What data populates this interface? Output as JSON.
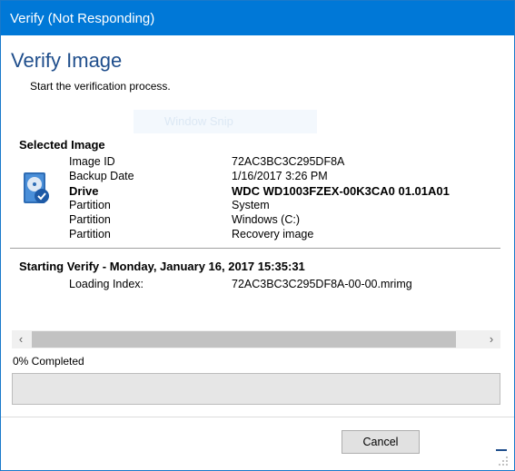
{
  "window": {
    "title": "Verify (Not Responding)"
  },
  "header": {
    "title": "Verify Image",
    "subtitle": "Start the verification process."
  },
  "ghost_overlay": {
    "text": "Window Snip"
  },
  "selected_image": {
    "title": "Selected Image",
    "icon": "hard-drive-icon",
    "rows": [
      {
        "label": "Image ID",
        "value": "72AC3BC3C295DF8A",
        "bold": false
      },
      {
        "label": "Backup Date",
        "value": "1/16/2017 3:26 PM",
        "bold": false
      },
      {
        "label": "Drive",
        "value": "WDC WD1003FZEX-00K3CA0 01.01A01",
        "bold": true
      },
      {
        "label": "Partition",
        "value": "System",
        "bold": false
      },
      {
        "label": "Partition",
        "value": "Windows (C:)",
        "bold": false
      },
      {
        "label": "Partition",
        "value": "Recovery image",
        "bold": false
      }
    ]
  },
  "verify": {
    "title": "Starting Verify - Monday, January 16, 2017 15:35:31",
    "rows": [
      {
        "label": "Loading Index:",
        "value": "72AC3BC3C295DF8A-00-00.mrimg"
      }
    ]
  },
  "scrollbar": {
    "left_arrow": "‹",
    "right_arrow": "›"
  },
  "progress": {
    "label": "0% Completed",
    "fraction": 0.0,
    "fill_color": "#06b025"
  },
  "buttons": {
    "cancel": "Cancel"
  },
  "colors": {
    "titlebar": "#0078d7",
    "heading": "#1f4e8c"
  }
}
